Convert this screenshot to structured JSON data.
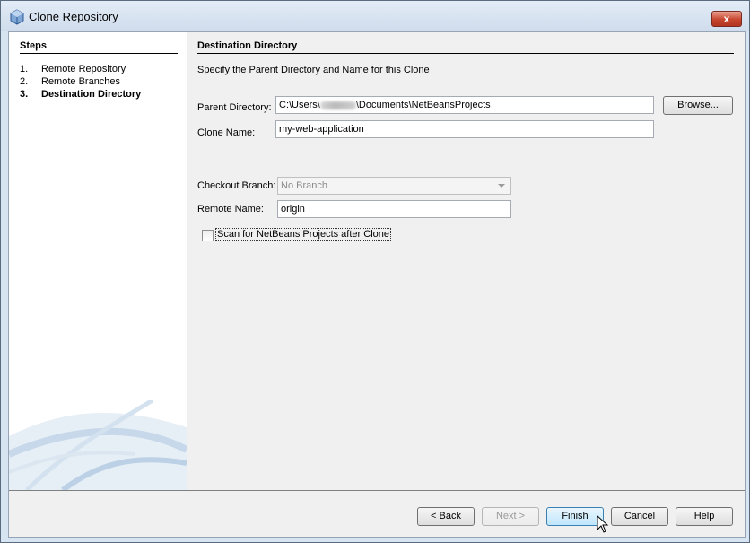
{
  "window": {
    "title": "Clone Repository",
    "close_glyph": "x"
  },
  "steps": {
    "title": "Steps",
    "items": [
      {
        "num": "1.",
        "label": "Remote Repository"
      },
      {
        "num": "2.",
        "label": "Remote Branches"
      },
      {
        "num": "3.",
        "label": "Destination Directory",
        "current": true
      }
    ]
  },
  "main": {
    "title": "Destination Directory",
    "subtitle": "Specify the Parent Directory and Name for this Clone",
    "parent_directory": {
      "label": "Parent Directory:",
      "value_prefix": "C:\\Users\\",
      "value_suffix": "\\Documents\\NetBeansProjects"
    },
    "browse_button": "Browse...",
    "clone_name": {
      "label": "Clone Name:",
      "value": "my-web-application"
    },
    "checkout_branch": {
      "label": "Checkout Branch:",
      "value": "No Branch"
    },
    "remote_name": {
      "label": "Remote Name:",
      "value": "origin"
    },
    "scan_checkbox": {
      "label": "Scan for NetBeans Projects after Clone",
      "checked": false
    }
  },
  "footer": {
    "back": "< Back",
    "next": "Next >",
    "finish": "Finish",
    "cancel": "Cancel",
    "help": "Help"
  },
  "colors": {
    "accent": "#3c7fb1",
    "close_button": "#c7452d",
    "title_bar": "#d7e4f2"
  }
}
